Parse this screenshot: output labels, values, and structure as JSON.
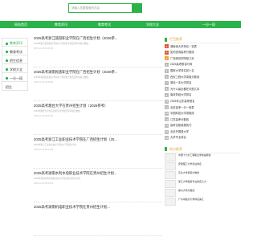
{
  "search": {
    "placeholder": "请输入您要搜索的内容"
  },
  "nav": {
    "items": [
      "网站首页",
      "教育资讯",
      "教育考试",
      "学校大全",
      "一分一段"
    ]
  },
  "sidebar": {
    "items": [
      {
        "label": "教育资讯",
        "active": true
      },
      {
        "label": "教育考试",
        "active": false
      },
      {
        "label": "招生信息",
        "active": false
      },
      {
        "label": "学校大全",
        "active": false
      },
      {
        "label": "一分一段",
        "active": false
      },
      {
        "label": "招生",
        "active": false
      }
    ]
  },
  "articles": [
    {
      "title": "2025高考浙江旅游职业学院在广西招生计划（2026参...",
      "snippet": "2025年浙江旅游职业学院在广西招生计划及历年录取分数线...",
      "meta": "2025-12-25 09:20:59"
    },
    {
      "title": "2025高考湖南民族职业学院在广西招生计划（2026参...",
      "snippet": "2025年湖南民族职业学院在广西招生计划及历年录取分数线...",
      "meta": "2025-12-25 09:20:59"
    },
    {
      "title": "2025高考烟台大学在贵州招生计划（2026参考）",
      "snippet": "2025年烟台大学在贵州招生计划及历年录取分数线...",
      "meta": "2025-12-25 09:20:59"
    },
    {
      "title": "2025高考浙江工业职业技术学院在广西招生计划（20...",
      "snippet": "2025年浙江工业职业技术学院在广西招生计划...",
      "meta": "2025-12-25 09:20:59"
    },
    {
      "title": "2025高考湖南水利水电职业技术学院在贵州招生计划...",
      "snippet": "2025年湖南水利水电职业技术学院在贵州招生计划...",
      "meta": "2025-12-25 09:20:59"
    },
    {
      "title": "2025高考湖南机电职业技术学院在贵州招生计划...",
      "snippet": "",
      "meta": ""
    }
  ],
  "hot": {
    "title": "栏目推荐",
    "items": [
      "湖南省大学排名一览表",
      "如何查询高考分数线",
      "广西师范学院是几本",
      "2025高考报名时间",
      "国家大学排名前十名",
      "西安工程大学录取分数线",
      "湖北一本大学排名",
      "为什么最近都在问是几本",
      "南京财经大学排名",
      "2025年山东高考报名",
      "北京高考一分一段表",
      "中国科技大学录取线",
      "江苏高考分数线",
      "高考志愿填报技巧",
      "北京外国语大学",
      "大学专业排名"
    ]
  },
  "rec": {
    "title": "热点推荐",
    "items": [
      "中国十大水工程职业学校是哪些",
      "安徽理工大学就业排名",
      "东北大学录取分数线",
      "浙江大学强势专业排名几大...",
      "郑州大学分数线",
      "广州中医药大学排名第几"
    ]
  }
}
